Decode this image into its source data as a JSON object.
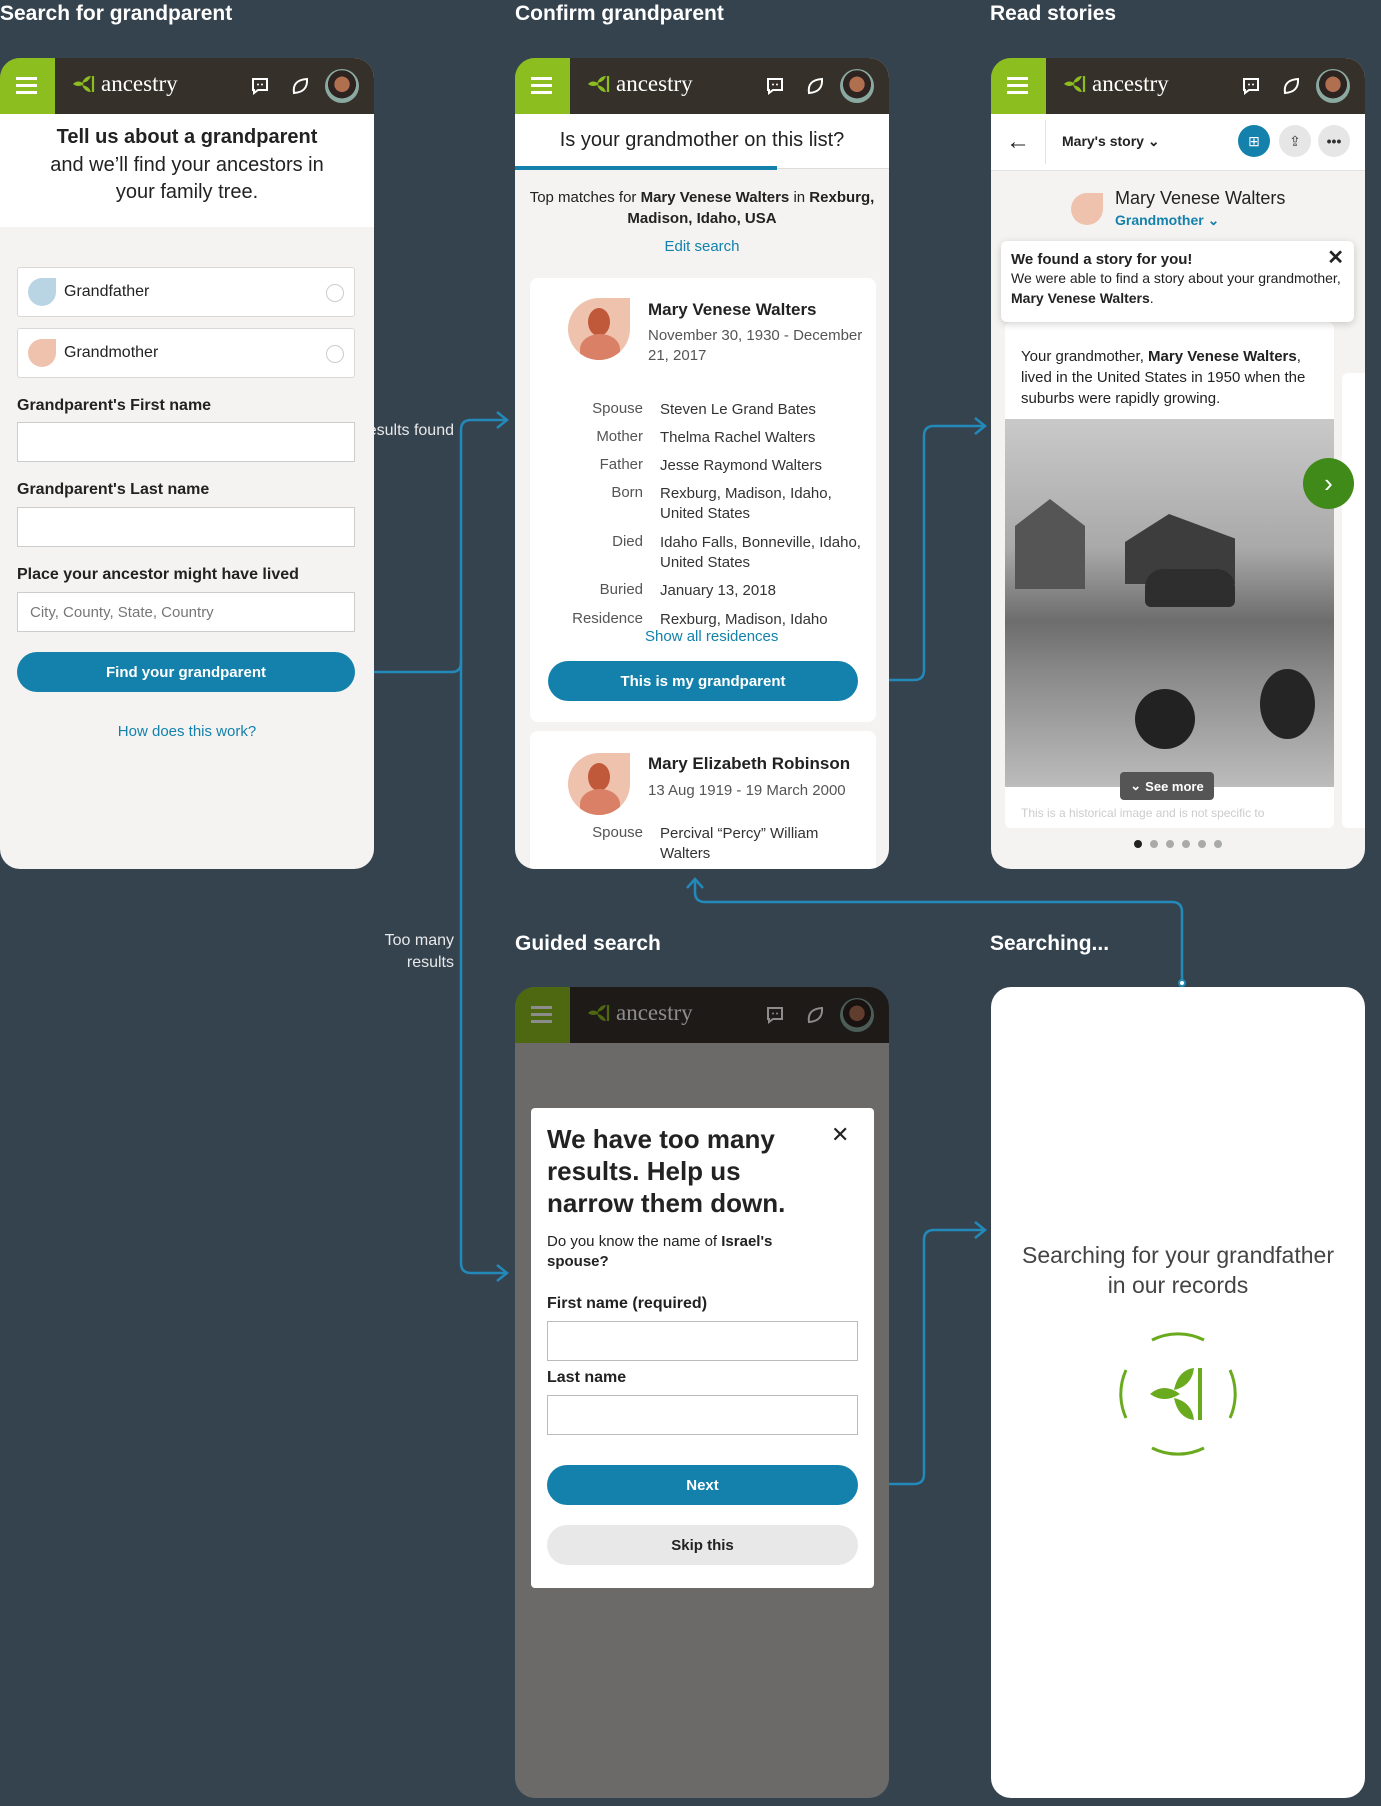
{
  "titles": {
    "search": "Search for grandparent",
    "confirm": "Confirm grandparent",
    "read": "Read stories",
    "guided": "Guided search",
    "searching": "Searching..."
  },
  "connectors": {
    "results_found": "Results found",
    "too_many": "Too many results",
    "color": "#2389b8"
  },
  "header": {
    "logo": "ancestry",
    "icons": [
      "menu-icon",
      "chat-icon",
      "leaf-hint-icon",
      "profile-avatar"
    ]
  },
  "search": {
    "heading": "Tell us about a grandparent",
    "subheading": "and we’ll find your ancestors in your family tree.",
    "options": [
      "Grandfather",
      "Grandmother"
    ],
    "first_name_label": "Grandparent's First name",
    "first_name_value": "",
    "last_name_label": "Grandparent's Last name",
    "last_name_value": "",
    "place_label": "Place your ancestor might have lived",
    "place_placeholder": "City, County, State, Country",
    "find_button": "Find your grandparent",
    "how_link": "How does this work?"
  },
  "confirm": {
    "question": "Is your grandmother on this list?",
    "progress_percent": 70,
    "top_matches_prefix": "Top matches for ",
    "query_name": "Mary Venese Walters",
    "in": " in ",
    "query_place": "Rexburg, Madison, Idaho, USA",
    "edit_search": "Edit search",
    "match1": {
      "name": "Mary Venese Walters",
      "dates": "November 30, 1930 - December 21, 2017",
      "rows": [
        {
          "label": "Spouse",
          "value": "Steven Le Grand Bates"
        },
        {
          "label": "Mother",
          "value": "Thelma Rachel Walters"
        },
        {
          "label": "Father",
          "value": "Jesse Raymond Walters"
        },
        {
          "label": "Born",
          "value": "Rexburg, Madison, Idaho, United States"
        },
        {
          "label": "Died",
          "value": "Idaho Falls, Bonneville, Idaho, United States"
        },
        {
          "label": "Buried",
          "value": "January 13, 2018"
        },
        {
          "label": "Residence",
          "value": "Rexburg, Madison, Idaho"
        }
      ],
      "show_all": "Show all residences",
      "confirm_button": "This is my grandparent"
    },
    "match2": {
      "name": "Mary Elizabeth Robinson",
      "dates": "13 Aug 1919 - 19 March 2000",
      "spouse_label": "Spouse",
      "spouse_value": "Percival “Percy” William Walters"
    }
  },
  "story": {
    "story_selector": "Mary's story",
    "person_name": "Mary Venese Walters",
    "relation": "Grandmother",
    "tooltip_title": "We found a story for you!",
    "tooltip_text": "We were able to find a story about your grandmother, ",
    "tooltip_name": "Mary Venese Walters",
    "tooltip_end": ".",
    "body_prefix": "Your grandmother, ",
    "body_name": "Mary Venese Walters",
    "body_rest": ", lived in the United States in 1950 when the suburbs were rapidly growing.",
    "see_more": "See more",
    "caption": "This is a historical image and is not specific to",
    "dots_total": 6,
    "dots_active": 1
  },
  "guided": {
    "title": "We have too many results. Help us narrow them down.",
    "question_prefix": "Do you know the name of ",
    "question_bold": "Israel's spouse?",
    "first_label": "First name (required)",
    "first_value": "",
    "last_label": "Last name",
    "last_value": "",
    "next": "Next",
    "skip": "Skip this"
  },
  "searching": {
    "text": "Searching for your grandfather in our records"
  }
}
